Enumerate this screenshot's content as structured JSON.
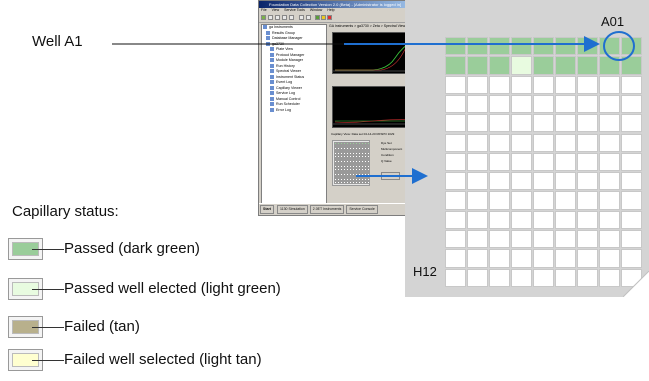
{
  "callout": {
    "well_a1": "Well A1"
  },
  "plate": {
    "top_right_label": "A01",
    "bottom_left_label": "H12"
  },
  "legend": {
    "title": "Capillary status:",
    "items": [
      {
        "label": "Passed (dark green)",
        "color": "#9acd9a"
      },
      {
        "label": "Passed well elected (light green)",
        "color": "#e8fbe0"
      },
      {
        "label": "Failed (tan)",
        "color": "#b8b08c"
      },
      {
        "label": "Failed well selected (light tan)",
        "color": "#ffffd0"
      }
    ]
  },
  "app": {
    "title": "Foundation Data Collection Version 2.0 (Beta) - [Administrator is logged in]",
    "menu": [
      "File",
      "View",
      "Service Tools",
      "Window",
      "Help"
    ],
    "tree_items": [
      "ga Instruments",
      "Results Group",
      "Database Manager",
      "ga3730",
      "Plate View",
      "Protocol Manager",
      "Module Manager",
      "Run History",
      "Spectral Viewer",
      "Instrument Status",
      "Event Log",
      "Capillary Viewer",
      "Service Log",
      "Manual Control",
      "Run Scheduler",
      "Error Log"
    ],
    "detail_header": "GA Instruments > ga3730 > Zeta > Spectral Viewer",
    "capillary_header": "Capillary View: Data set 04-14-20 RFSPO 1029",
    "side_fields": [
      "Dye Set",
      "Multicomponent",
      "Condition",
      "Q Value",
      "Overwrite"
    ],
    "taskbar": {
      "start": "Start",
      "tasks": [
        "1130 Simulation",
        "2.0ET Instruments",
        "Service Console"
      ]
    },
    "colors": {
      "titlebar": "#0a246a",
      "plot_bg": "#000000"
    }
  },
  "colors": {
    "arrow": "#1f6fd0",
    "plate_bg": "#d4d4d4",
    "well_empty": "#ffffff",
    "well_passed": "#9acd9a",
    "well_passed_selected": "#e8fbe0"
  }
}
